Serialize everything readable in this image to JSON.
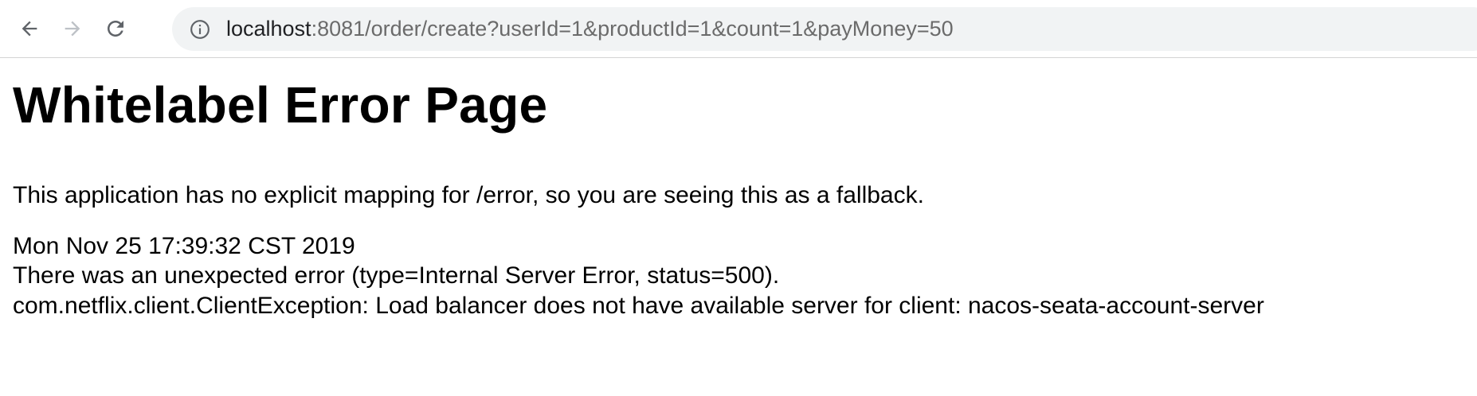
{
  "browser": {
    "back_icon": "arrow-left-icon",
    "forward_icon": "arrow-right-icon",
    "reload_icon": "reload-icon",
    "info_icon": "info-circle-icon",
    "url_host": "localhost",
    "url_rest": ":8081/order/create?userId=1&productId=1&count=1&payMoney=50"
  },
  "page": {
    "title": "Whitelabel Error Page",
    "message": "This application has no explicit mapping for /error, so you are seeing this as a fallback.",
    "timestamp": "Mon Nov 25 17:39:32 CST 2019",
    "error_line": "There was an unexpected error (type=Internal Server Error, status=500).",
    "exception": "com.netflix.client.ClientException: Load balancer does not have available server for client: nacos-seata-account-server"
  },
  "colors": {
    "toolbar_bg": "#ffffff",
    "omnibox_bg": "#f1f3f4",
    "icon_active": "#5f6368",
    "icon_disabled": "#bdc1c6",
    "url_host": "#202124",
    "url_rest": "#6b6b6b"
  }
}
